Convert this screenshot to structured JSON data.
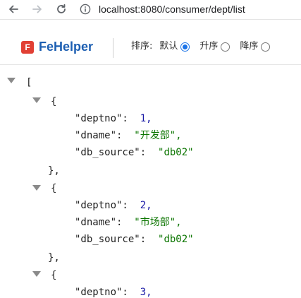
{
  "browser": {
    "url": "localhost:8080/consumer/dept/list"
  },
  "fehelper": {
    "logo_letter": "F",
    "title": "FeHelper",
    "sort_label": "排序:",
    "options": [
      {
        "label": "默认",
        "checked": true
      },
      {
        "label": "升序",
        "checked": false
      },
      {
        "label": "降序",
        "checked": false
      }
    ]
  },
  "json": {
    "open_array": "[",
    "open_obj": "{",
    "close_obj": "},",
    "records": [
      {
        "deptno_key": "\"deptno\":",
        "deptno": "1,",
        "dname_key": "\"dname\":",
        "dname": "\"开发部\",",
        "db_key": "\"db_source\":",
        "db": "\"db02\""
      },
      {
        "deptno_key": "\"deptno\":",
        "deptno": "2,",
        "dname_key": "\"dname\":",
        "dname": "\"市场部\",",
        "db_key": "\"db_source\":",
        "db": "\"db02\""
      },
      {
        "deptno_key": "\"deptno\":",
        "deptno": "3,"
      }
    ]
  },
  "colors": {
    "brand": "#1d5fb2",
    "logo": "#e14034",
    "number": "#1a1aa6",
    "string": "#0b7500"
  }
}
